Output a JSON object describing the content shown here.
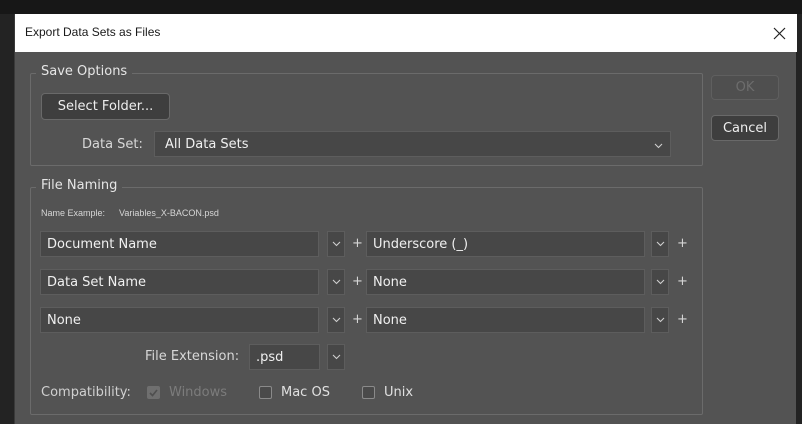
{
  "dialog": {
    "title": "Export Data Sets as Files"
  },
  "save_options": {
    "legend": "Save Options",
    "select_folder_label": "Select Folder...",
    "data_set_label": "Data Set:",
    "data_set_value": "All Data Sets"
  },
  "buttons": {
    "ok_label": "OK",
    "cancel_label": "Cancel"
  },
  "file_naming": {
    "legend": "File Naming",
    "name_example_label": "Name Example:",
    "name_example_value": "Variables_X-BACON.psd",
    "rows": [
      {
        "left": "Document Name",
        "right": "Underscore (_)"
      },
      {
        "left": "Data Set Name",
        "right": "None"
      },
      {
        "left": "None",
        "right": "None"
      }
    ],
    "plus_symbol": "+",
    "file_extension_label": "File Extension:",
    "file_extension_value": ".psd"
  },
  "compatibility": {
    "label": "Compatibility:",
    "options": [
      {
        "label": "Windows",
        "checked": true,
        "disabled": true
      },
      {
        "label": "Mac OS",
        "checked": false,
        "disabled": false
      },
      {
        "label": "Unix",
        "checked": false,
        "disabled": false
      }
    ]
  },
  "icons": {
    "close": "close-icon",
    "dropdown": "chevron-down-icon",
    "check": "check-icon"
  },
  "colors": {
    "dialog_bg": "#535353",
    "field_bg": "#474747",
    "titlebar_bg": "#ffffff"
  }
}
